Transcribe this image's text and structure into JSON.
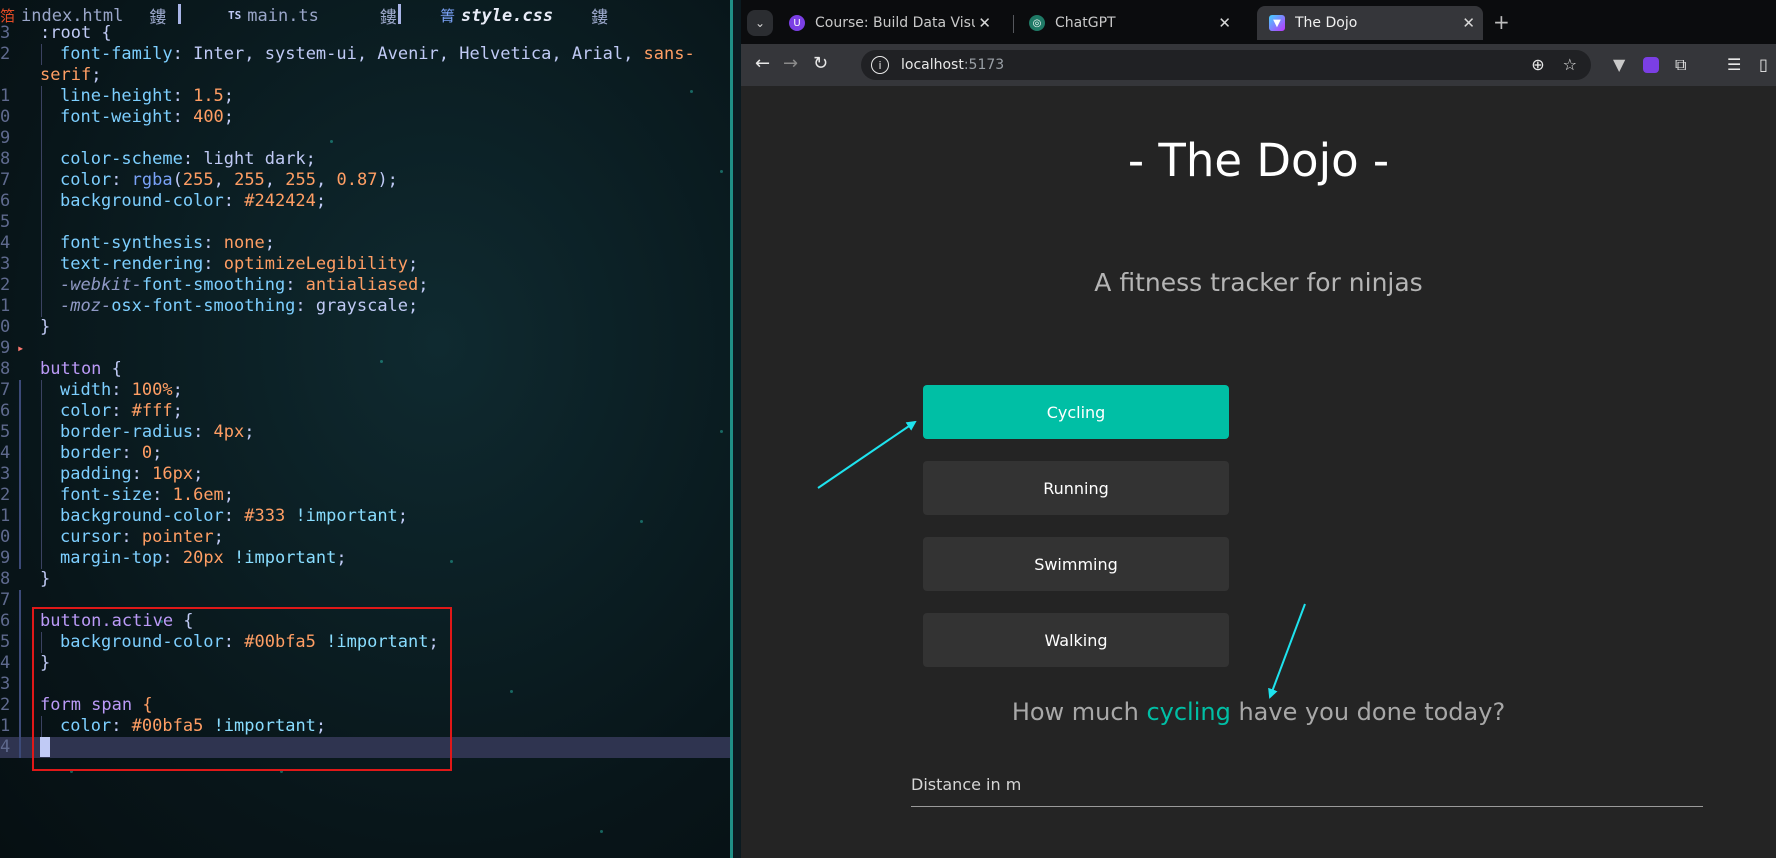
{
  "editor": {
    "tabs": [
      {
        "name": "index.html",
        "glyph": "鏤",
        "icon": "html-icon",
        "icon_glyph": "箔",
        "active": false
      },
      {
        "name": "main.ts",
        "glyph": "鏤",
        "icon": "ts-icon",
        "icon_glyph": "TS",
        "active": false
      },
      {
        "name": "style.css",
        "glyph": "鏤",
        "icon": "css-icon",
        "icon_glyph": "箐",
        "active": true
      }
    ],
    "lines": [
      {
        "n": "3",
        "tokens": [
          [
            ":root {",
            "t-txt"
          ]
        ]
      },
      {
        "n": "2",
        "guide": true,
        "tokens": [
          [
            "font-family",
            "t-prop"
          ],
          [
            ": ",
            "t-punc"
          ],
          [
            "Inter",
            "t-txt"
          ],
          [
            ", ",
            "t-punc"
          ],
          [
            "system-ui",
            "t-txt"
          ],
          [
            ", ",
            "t-punc"
          ],
          [
            "Avenir",
            "t-txt"
          ],
          [
            ", ",
            "t-punc"
          ],
          [
            "Helvetica",
            "t-txt"
          ],
          [
            ", ",
            "t-punc"
          ],
          [
            "Arial",
            "t-txt"
          ],
          [
            ", ",
            "t-punc"
          ],
          [
            "sans-",
            "t-kw"
          ]
        ]
      },
      {
        "n": "",
        "tokens": [
          [
            "serif",
            "t-kw"
          ],
          [
            ";",
            "t-punc"
          ]
        ]
      },
      {
        "n": "1",
        "guide": true,
        "tokens": [
          [
            "line-height",
            "t-prop"
          ],
          [
            ": ",
            "t-punc"
          ],
          [
            "1.5",
            "t-num"
          ],
          [
            ";",
            "t-punc"
          ]
        ]
      },
      {
        "n": "0",
        "guide": true,
        "tokens": [
          [
            "font-weight",
            "t-prop"
          ],
          [
            ": ",
            "t-punc"
          ],
          [
            "400",
            "t-num"
          ],
          [
            ";",
            "t-punc"
          ]
        ]
      },
      {
        "n": "9",
        "guide": true,
        "tokens": []
      },
      {
        "n": "8",
        "guide": true,
        "tokens": [
          [
            "color-scheme",
            "t-prop"
          ],
          [
            ": ",
            "t-punc"
          ],
          [
            "light dark",
            "t-txt"
          ],
          [
            ";",
            "t-punc"
          ]
        ]
      },
      {
        "n": "7",
        "guide": true,
        "tokens": [
          [
            "color",
            "t-prop"
          ],
          [
            ": ",
            "t-punc"
          ],
          [
            "rgba",
            "t-fn"
          ],
          [
            "(",
            "t-punc"
          ],
          [
            "255",
            "t-num"
          ],
          [
            ", ",
            "t-punc"
          ],
          [
            "255",
            "t-num"
          ],
          [
            ", ",
            "t-punc"
          ],
          [
            "255",
            "t-num"
          ],
          [
            ", ",
            "t-punc"
          ],
          [
            "0.87",
            "t-num"
          ],
          [
            ");",
            "t-punc"
          ]
        ]
      },
      {
        "n": "6",
        "guide": true,
        "tokens": [
          [
            "background-color",
            "t-prop"
          ],
          [
            ": ",
            "t-punc"
          ],
          [
            "#242424",
            "t-num"
          ],
          [
            ";",
            "t-punc"
          ]
        ]
      },
      {
        "n": "5",
        "guide": true,
        "tokens": []
      },
      {
        "n": "4",
        "guide": true,
        "tokens": [
          [
            "font-synthesis",
            "t-prop"
          ],
          [
            ": ",
            "t-punc"
          ],
          [
            "none",
            "t-kw"
          ],
          [
            ";",
            "t-punc"
          ]
        ]
      },
      {
        "n": "3",
        "guide": true,
        "tokens": [
          [
            "text-rendering",
            "t-prop"
          ],
          [
            ": ",
            "t-punc"
          ],
          [
            "optimizeLegibility",
            "t-kw"
          ],
          [
            ";",
            "t-punc"
          ]
        ]
      },
      {
        "n": "2",
        "guide": true,
        "tokens": [
          [
            "-webkit-",
            "t-vnd"
          ],
          [
            "font-smoothing",
            "t-prop"
          ],
          [
            ": ",
            "t-punc"
          ],
          [
            "antialiased",
            "t-kw"
          ],
          [
            ";",
            "t-punc"
          ]
        ]
      },
      {
        "n": "1",
        "guide": true,
        "tokens": [
          [
            "-moz-",
            "t-vnd"
          ],
          [
            "osx-font-smoothing",
            "t-prop"
          ],
          [
            ": ",
            "t-punc"
          ],
          [
            "grayscale",
            "t-txt"
          ],
          [
            ";",
            "t-punc"
          ]
        ]
      },
      {
        "n": "0",
        "tokens": [
          [
            "}",
            "t-punc"
          ]
        ]
      },
      {
        "n": "9",
        "fold": true,
        "tokens": []
      },
      {
        "n": "8",
        "tokens": [
          [
            "button",
            "t-sel"
          ],
          [
            " {",
            "t-punc"
          ]
        ]
      },
      {
        "n": "7",
        "git": true,
        "guide": true,
        "tokens": [
          [
            "width",
            "t-prop"
          ],
          [
            ": ",
            "t-punc"
          ],
          [
            "100%",
            "t-num"
          ],
          [
            ";",
            "t-punc"
          ]
        ]
      },
      {
        "n": "6",
        "git": true,
        "guide": true,
        "tokens": [
          [
            "color",
            "t-prop"
          ],
          [
            ": ",
            "t-punc"
          ],
          [
            "#fff",
            "t-num"
          ],
          [
            ";",
            "t-punc"
          ]
        ]
      },
      {
        "n": "5",
        "git": true,
        "guide": true,
        "tokens": [
          [
            "border-radius",
            "t-prop"
          ],
          [
            ": ",
            "t-punc"
          ],
          [
            "4px",
            "t-num"
          ],
          [
            ";",
            "t-punc"
          ]
        ]
      },
      {
        "n": "4",
        "git": true,
        "guide": true,
        "tokens": [
          [
            "border",
            "t-prop"
          ],
          [
            ": ",
            "t-punc"
          ],
          [
            "0",
            "t-num"
          ],
          [
            ";",
            "t-punc"
          ]
        ]
      },
      {
        "n": "3",
        "git": true,
        "guide": true,
        "tokens": [
          [
            "padding",
            "t-prop"
          ],
          [
            ": ",
            "t-punc"
          ],
          [
            "16px",
            "t-num"
          ],
          [
            ";",
            "t-punc"
          ]
        ]
      },
      {
        "n": "2",
        "git": true,
        "guide": true,
        "tokens": [
          [
            "font-size",
            "t-prop"
          ],
          [
            ": ",
            "t-punc"
          ],
          [
            "1.6em",
            "t-num"
          ],
          [
            ";",
            "t-punc"
          ]
        ]
      },
      {
        "n": "1",
        "git": true,
        "guide": true,
        "tokens": [
          [
            "background-color",
            "t-prop"
          ],
          [
            ": ",
            "t-punc"
          ],
          [
            "#333",
            "t-num"
          ],
          [
            " !important",
            "t-imp"
          ],
          [
            ";",
            "t-punc"
          ]
        ]
      },
      {
        "n": "0",
        "git": true,
        "guide": true,
        "tokens": [
          [
            "cursor",
            "t-prop"
          ],
          [
            ": ",
            "t-punc"
          ],
          [
            "pointer",
            "t-kw"
          ],
          [
            ";",
            "t-punc"
          ]
        ]
      },
      {
        "n": "9",
        "git": true,
        "guide": true,
        "tokens": [
          [
            "margin-top",
            "t-prop"
          ],
          [
            ": ",
            "t-punc"
          ],
          [
            "20px",
            "t-num"
          ],
          [
            " !important",
            "t-imp"
          ],
          [
            ";",
            "t-punc"
          ]
        ]
      },
      {
        "n": "8",
        "tokens": [
          [
            "}",
            "t-punc"
          ]
        ]
      },
      {
        "n": "7",
        "git": true,
        "tokens": []
      },
      {
        "n": "6",
        "git": true,
        "tokens": [
          [
            "button.active",
            "t-sel"
          ],
          [
            " {",
            "t-punc"
          ]
        ]
      },
      {
        "n": "5",
        "git": true,
        "guide": true,
        "tokens": [
          [
            "background-color",
            "t-prop"
          ],
          [
            ": ",
            "t-punc"
          ],
          [
            "#00bfa5",
            "t-num"
          ],
          [
            " !important",
            "t-imp"
          ],
          [
            ";",
            "t-punc"
          ]
        ]
      },
      {
        "n": "4",
        "git": true,
        "tokens": [
          [
            "}",
            "t-punc"
          ]
        ]
      },
      {
        "n": "3",
        "git": true,
        "tokens": []
      },
      {
        "n": "2",
        "git": true,
        "tokens": [
          [
            "form span",
            "t-sel"
          ],
          [
            " {",
            "t-kw"
          ]
        ]
      },
      {
        "n": "1",
        "git": true,
        "guide": true,
        "tokens": [
          [
            "color",
            "t-prop"
          ],
          [
            ": ",
            "t-punc"
          ],
          [
            "#00bfa5",
            "t-num"
          ],
          [
            " !important",
            "t-imp"
          ],
          [
            ";",
            "t-punc"
          ]
        ]
      },
      {
        "n": "4",
        "git": true,
        "current": true,
        "cursor": true,
        "tokens": [
          [
            "}",
            "t-punc"
          ]
        ]
      }
    ]
  },
  "browser": {
    "tabs": [
      {
        "title": "Course: Build Data Visua",
        "favicon": "course-favicon-icon",
        "fav_bg": "#7b3fe4",
        "fav_glyph": "U",
        "active": false
      },
      {
        "title": "ChatGPT",
        "favicon": "chatgpt-favicon-icon",
        "fav_bg": "#1f7a66",
        "fav_glyph": "◎",
        "active": false
      },
      {
        "title": "The Dojo",
        "favicon": "vite-favicon-icon",
        "fav_bg": "#8b5cf6",
        "fav_glyph": "▼",
        "active": true
      }
    ],
    "new_tab_glyph": "+",
    "url_host": "localhost",
    "url_port": ":5173"
  },
  "page": {
    "title": "- The Dojo -",
    "subtitle": "A fitness tracker for ninjas",
    "activities": [
      {
        "label": "Cycling",
        "active": true
      },
      {
        "label": "Running",
        "active": false
      },
      {
        "label": "Swimming",
        "active": false
      },
      {
        "label": "Walking",
        "active": false
      }
    ],
    "question_pre": "How much ",
    "question_highlight": "cycling",
    "question_post": " have you done today?",
    "distance_label": "Distance in m"
  },
  "colors": {
    "accent": "#00bfa5",
    "button_bg": "#333",
    "page_bg": "#242424",
    "annotation_box": "#e01818",
    "annotation_arrow": "#1ee3ee"
  }
}
